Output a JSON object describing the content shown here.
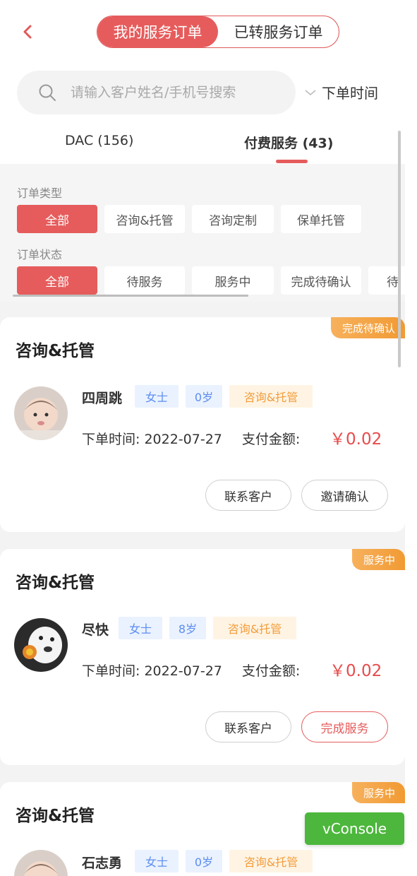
{
  "header": {
    "segments": [
      "我的服务订单",
      "已转服务订单"
    ],
    "active_segment": 0
  },
  "search": {
    "placeholder": "请输入客户姓名/手机号搜索",
    "sort_label": "下单时间"
  },
  "tabs": [
    {
      "label": "DAC (156)",
      "active": false
    },
    {
      "label": "付费服务 (43)",
      "active": true
    }
  ],
  "filters": {
    "type_label": "订单类型",
    "type_options": [
      "全部",
      "咨询&托管",
      "咨询定制",
      "保单托管"
    ],
    "status_label": "订单状态",
    "status_options": [
      "全部",
      "待服务",
      "服务中",
      "完成待确认",
      "待"
    ]
  },
  "orders": [
    {
      "title": "咨询&托管",
      "status": "完成待确认",
      "name": "四周跳",
      "gender": "女士",
      "age": "0岁",
      "service": "咨询&托管",
      "order_time_label": "下单时间:",
      "order_time": "2022-07-27",
      "amount_label": "支付金额:",
      "amount": "￥0.02",
      "buttons": [
        "联系客户",
        "邀请确认"
      ]
    },
    {
      "title": "咨询&托管",
      "status": "服务中",
      "name": "尽快",
      "gender": "女士",
      "age": "8岁",
      "service": "咨询&托管",
      "order_time_label": "下单时间:",
      "order_time": "2022-07-27",
      "amount_label": "支付金额:",
      "amount": "￥0.02",
      "buttons": [
        "联系客户",
        "完成服务"
      ]
    },
    {
      "title": "咨询&托管",
      "status": "服务中",
      "name": "石志勇",
      "gender": "女士",
      "age": "0岁",
      "service": "咨询&托管"
    }
  ],
  "vconsole_label": "vConsole",
  "colors": {
    "accent": "#e65c5c",
    "status_badge": "#f19a33",
    "price": "#e84b4b",
    "vconsole": "#4cb73c"
  }
}
